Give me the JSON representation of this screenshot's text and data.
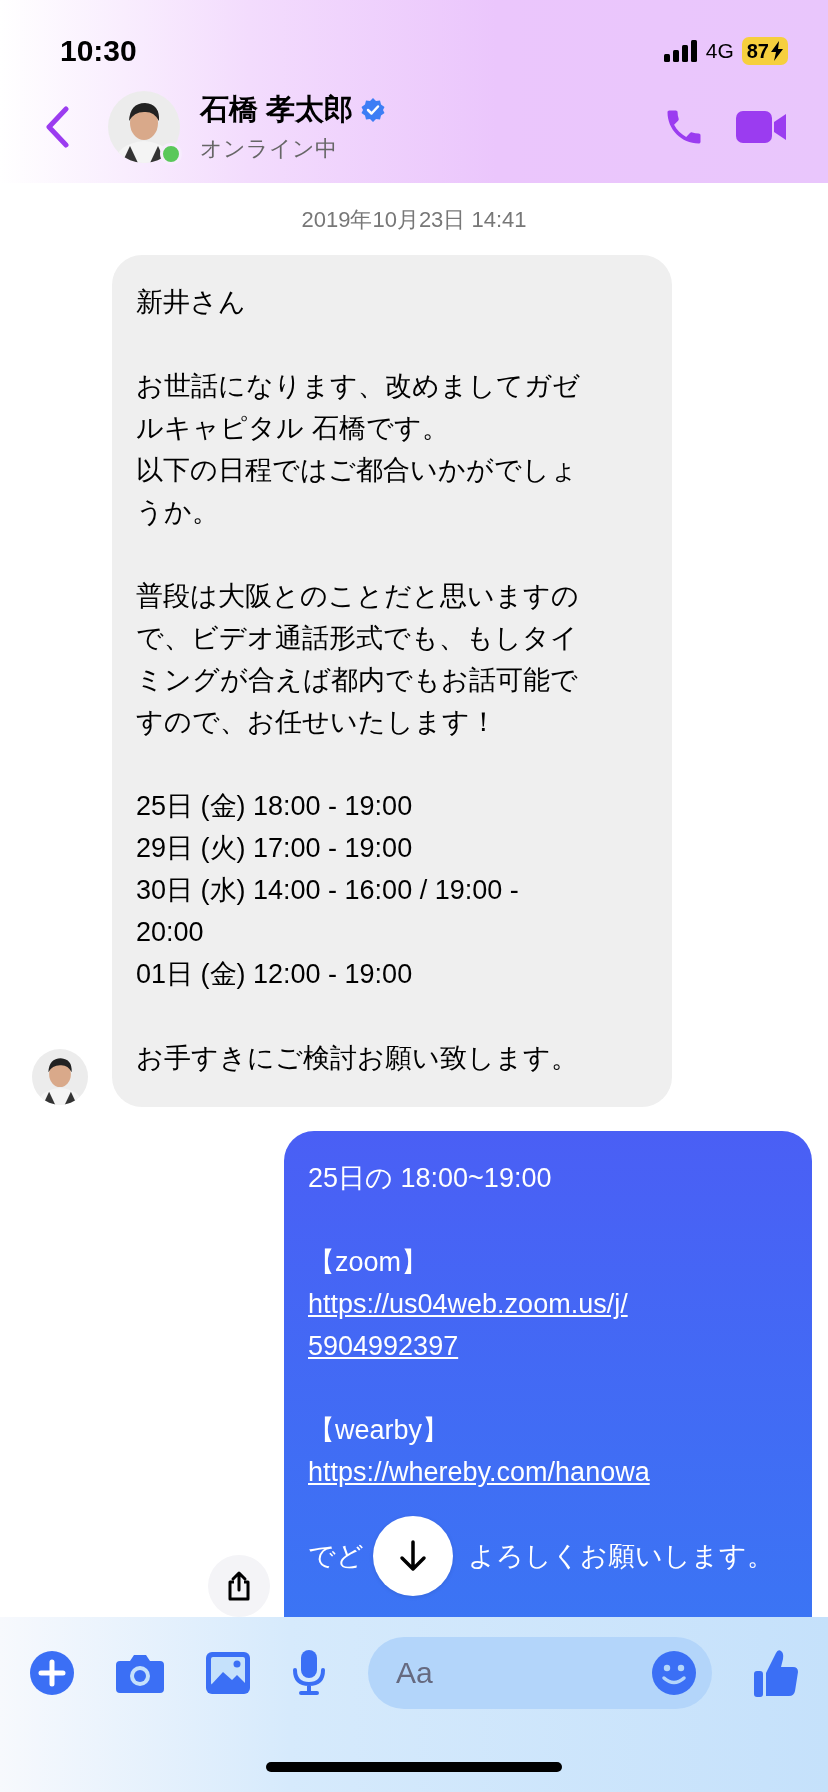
{
  "status_bar": {
    "time": "10:30",
    "network": "4G",
    "battery": "87",
    "charging": true
  },
  "header": {
    "name": "石橋 孝太郎",
    "verified": true,
    "status": "オンライン中",
    "online": true
  },
  "date": "2019年10月23日 14:41",
  "messages": [
    {
      "kind": "incoming",
      "paragraphs": [
        [
          {
            "kind": "text",
            "text": "新井さん"
          }
        ],
        [
          {
            "kind": "text",
            "text": "お世話になります、改めましてガゼ"
          },
          {
            "kind": "text",
            "text": "ルキャピタル 石橋です。"
          },
          {
            "kind": "text",
            "text": "以下の日程ではご都合いかがでしょ"
          },
          {
            "kind": "text",
            "text": "うか。"
          }
        ],
        [
          {
            "kind": "text",
            "text": "普段は大阪とのことだと思いますの"
          },
          {
            "kind": "text",
            "text": "で、ビデオ通話形式でも、もしタイ"
          },
          {
            "kind": "text",
            "text": "ミングが合えば都内でもお話可能で"
          },
          {
            "kind": "text",
            "text": "すので、お任せいたします！"
          }
        ],
        [
          {
            "kind": "text",
            "text": "25日 (金) 18:00 - 19:00"
          },
          {
            "kind": "text",
            "text": "29日 (火) 17:00 - 19:00"
          },
          {
            "kind": "text",
            "text": "30日 (水) 14:00 - 16:00 / 19:00 -"
          },
          {
            "kind": "text",
            "text": "20:00"
          },
          {
            "kind": "text",
            "text": "01日 (金) 12:00 - 19:00"
          }
        ],
        [
          {
            "kind": "text",
            "text": "お手すきにご検討お願い致します。"
          }
        ]
      ]
    },
    {
      "kind": "outgoing",
      "paragraphs": [
        [
          {
            "kind": "text",
            "text": "25日の 18:00~19:00"
          }
        ],
        [
          {
            "kind": "text",
            "text": "【zoom】"
          },
          {
            "kind": "link",
            "text": "https://us04web.zoom.us/j/\n5904992397"
          }
        ],
        [
          {
            "kind": "text",
            "text": "【wearby】"
          },
          {
            "kind": "link",
            "text": "https://whereby.com/hanowa"
          }
        ],
        [
          {
            "kind": "inline",
            "text": "でど"
          },
          {
            "kind": "inline",
            "text": "よろしくお願いします。"
          }
        ]
      ]
    }
  ],
  "composer": {
    "placeholder": "Aa"
  }
}
